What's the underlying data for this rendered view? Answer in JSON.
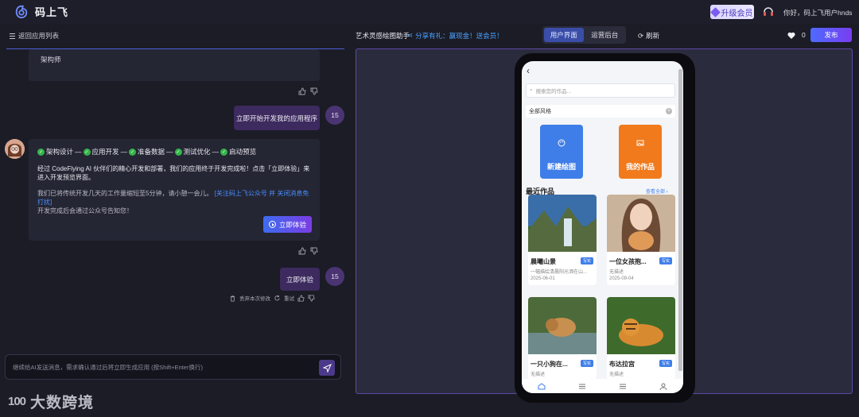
{
  "header": {
    "brand": "码上飞",
    "vip_label": "升级会员",
    "greeting": "你好，码上飞用户hnds"
  },
  "subbar": {
    "back_label": "返回应用列表",
    "app_title": "艺术灵感绘图助手",
    "share_label": "分享有礼：赢现金！送会员！",
    "views": [
      {
        "label": "用户界面",
        "active": true
      },
      {
        "label": "运营后台",
        "active": false
      }
    ],
    "refresh_label": "刷新",
    "like_count": "0",
    "publish_label": "发布"
  },
  "chat": {
    "top_message": "架构师",
    "user_msg_1": "立即开始开发我的应用程序",
    "user_avatar": "15",
    "steps": [
      "架构设计",
      "应用开发",
      "准备数据",
      "测试优化",
      "启动预览"
    ],
    "ai_para_1": "经过 CodeFlying AI 伙伴们的精心开发和部署，我们的应用终于开发完成啦！点击「立即体验」来进入开发预览界面。",
    "ai_para_2_a": "我们已将传统开发几天的工作量缩短至5分钟，请小憩一会儿。",
    "ai_para_2_link": "[关注码上飞公众号 并 关闭消息免打扰]",
    "ai_para_2_b": "开发完成后会通过公众号告知您！",
    "try_label": "立即体验",
    "user_msg_2": "立即体验",
    "discard_label": "丢弃本次修改",
    "retry_label": "重试",
    "input_placeholder": "继续给AI发送消息，需求确认通过后将立即生成应用 (按Shift+Enter换行)",
    "watermark": "大数跨境",
    "watermark_mark": "100"
  },
  "phone": {
    "search_placeholder": "搜索您的作品...",
    "filter_value": "全部风格",
    "tile_new": "新建绘图",
    "tile_mine": "我的作品",
    "recent_title": "最近作品",
    "view_all": "查看全部",
    "works": [
      {
        "name": "晨曦山景",
        "tag": "写实",
        "desc": "一幅描绘清晨阳光洒在山...",
        "date": "2025-06-01"
      },
      {
        "name": "一位女孩抱...",
        "tag": "写实",
        "desc": "无描述",
        "date": "2025-09-04"
      },
      {
        "name": "一只小狗在...",
        "tag": "写实",
        "desc": "无描述",
        "date": ""
      },
      {
        "name": "布达拉宫",
        "tag": "写实",
        "desc": "无描述",
        "date": ""
      }
    ]
  },
  "colors": {
    "background": "#1b1c26",
    "accent": "#4d6bff",
    "purple": "#7a3df0",
    "link": "#4aa0ff",
    "tile_blue": "#3f7ee8",
    "tile_orange": "#f07a1c"
  }
}
